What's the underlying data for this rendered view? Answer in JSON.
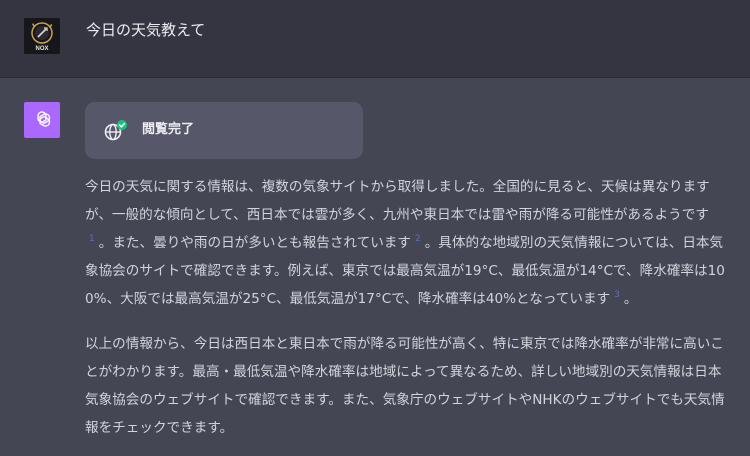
{
  "user": {
    "avatar_text": "NOX",
    "message": "今日の天気教えて"
  },
  "assistant": {
    "browse_status": "閲覧完了",
    "paragraph1": {
      "seg1": "今日の天気に関する情報は、複数の気象サイトから取得しました。全国的に見ると、天候は異なりますが、一般的な傾向として、西日本では雲が多く、九州や東日本では雷や雨が降る可能性があるようです",
      "cite1": "1",
      "seg2": "。また、曇りや雨の日が多いとも報告されています",
      "cite2": "2",
      "seg3": "。具体的な地域別の天気情報については、日本気象協会のサイトで確認できます。例えば、東京では最高気温が19°C、最低気温が14°Cで、降水確率は100%、大阪では最高気温が25°C、最低気温が17°Cで、降水確率は40%となっています",
      "cite3": "3",
      "seg4": "。"
    },
    "paragraph2": "以上の情報から、今日は西日本と東日本で雨が降る可能性が高く、特に東京では降水確率が非常に高いことがわかります。最高・最低気温や降水確率は地域によって異なるため、詳しい地域別の天気情報は日本気象協会のウェブサイトで確認できます。また、気象庁のウェブサイトやNHKのウェブサイトでも天気情報をチェックできます。"
  },
  "colors": {
    "user_row_bg": "#343541",
    "assistant_row_bg": "#444654",
    "assistant_avatar_bg": "#ab68ff",
    "pill_bg": "#565869",
    "check_green": "#19c37d",
    "citation": "#5a6ec7"
  }
}
